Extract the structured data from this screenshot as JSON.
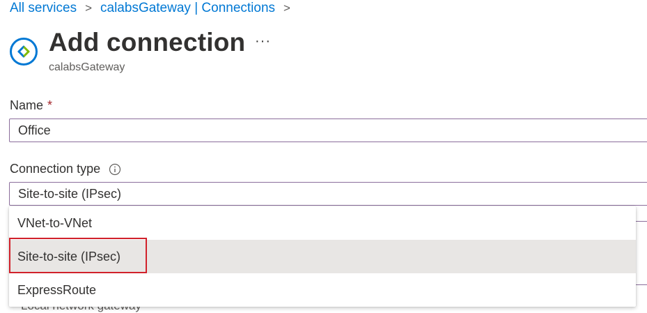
{
  "breadcrumb": {
    "items": [
      "All services",
      "calabsGateway | Connections"
    ],
    "separator": ">"
  },
  "header": {
    "title": "Add connection",
    "subtitle": "calabsGateway",
    "more_label": "···",
    "icon": "gateway-icon"
  },
  "form": {
    "name": {
      "label": "Name",
      "required_mark": "*",
      "value": "Office"
    },
    "connection_type": {
      "label": "Connection type",
      "value": "Site-to-site (IPsec)",
      "info_icon": "info-icon",
      "options": [
        "VNet-to-VNet",
        "Site-to-site (IPsec)",
        "ExpressRoute"
      ],
      "selected_index": 1
    },
    "local_network_gateway": {
      "label": "Local network gateway"
    }
  },
  "colors": {
    "link": "#0078d4",
    "highlight": "#d1212b",
    "input_border": "#8a6d9b",
    "selected_bg": "#e8e6e4"
  }
}
